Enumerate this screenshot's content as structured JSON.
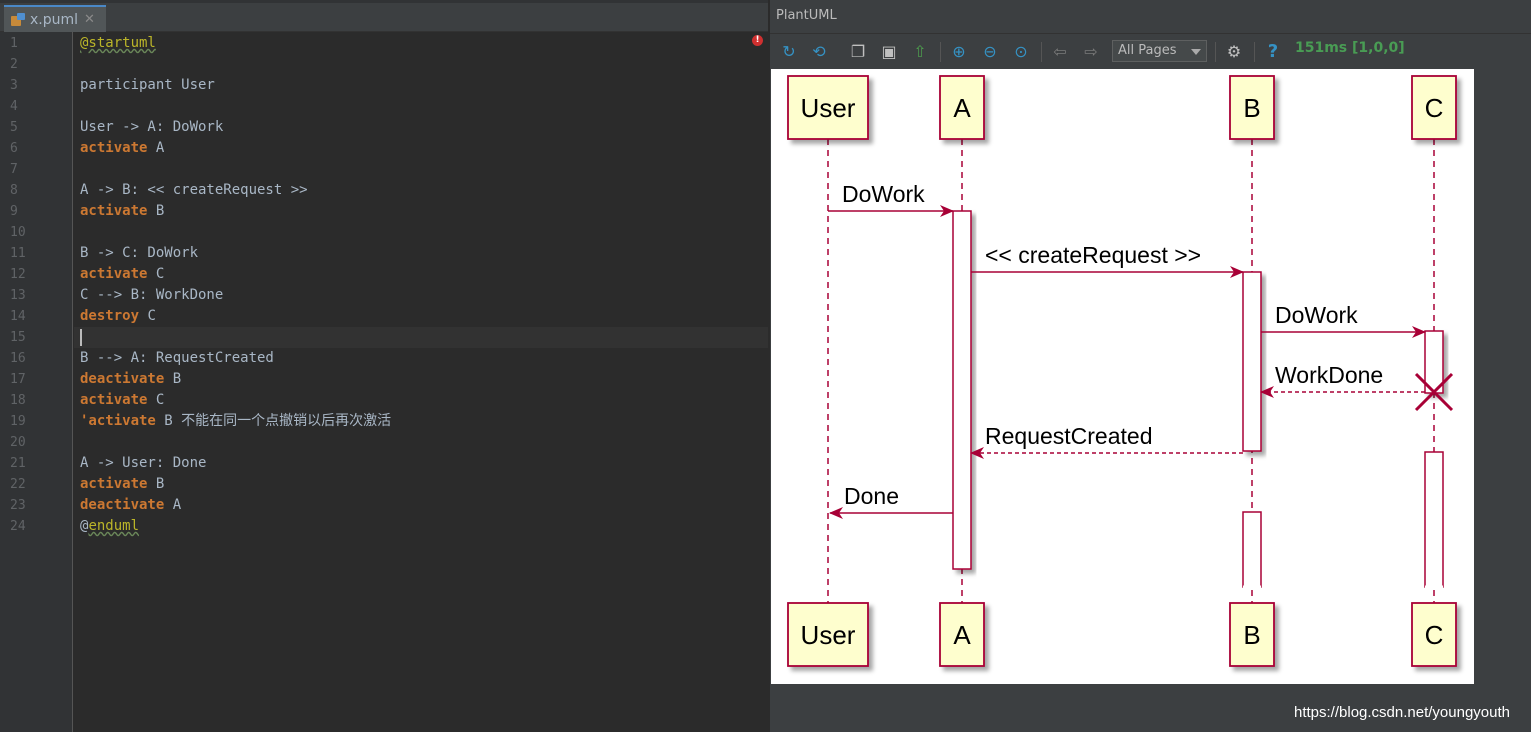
{
  "editor": {
    "tab": {
      "filename": "x.puml",
      "close": "✕"
    },
    "lines": [
      {
        "no": "1",
        "parts": [
          [
            "an",
            "@startuml"
          ]
        ]
      },
      {
        "no": "2",
        "parts": []
      },
      {
        "no": "3",
        "parts": [
          [
            "t",
            "participant User"
          ]
        ]
      },
      {
        "no": "4",
        "parts": []
      },
      {
        "no": "5",
        "parts": [
          [
            "t",
            "User -> A: DoWork"
          ]
        ]
      },
      {
        "no": "6",
        "parts": [
          [
            "kw",
            "activate"
          ],
          [
            "t",
            " A"
          ]
        ]
      },
      {
        "no": "7",
        "parts": []
      },
      {
        "no": "8",
        "parts": [
          [
            "t",
            "A -> B: << createRequest >>"
          ]
        ]
      },
      {
        "no": "9",
        "parts": [
          [
            "kw",
            "activate"
          ],
          [
            "t",
            " B"
          ]
        ]
      },
      {
        "no": "10",
        "parts": []
      },
      {
        "no": "11",
        "parts": [
          [
            "t",
            "B -> C: DoWork"
          ]
        ]
      },
      {
        "no": "12",
        "parts": [
          [
            "kw",
            "activate"
          ],
          [
            "t",
            " C"
          ]
        ]
      },
      {
        "no": "13",
        "parts": [
          [
            "t",
            "C --> B: WorkDone"
          ]
        ]
      },
      {
        "no": "14",
        "parts": [
          [
            "kw",
            "destroy"
          ],
          [
            "t",
            " C"
          ]
        ]
      },
      {
        "no": "15",
        "parts": [
          [
            "caret",
            ""
          ]
        ],
        "current": true
      },
      {
        "no": "16",
        "parts": [
          [
            "t",
            "B --> A: RequestCreated"
          ]
        ]
      },
      {
        "no": "17",
        "parts": [
          [
            "kw",
            "deactivate"
          ],
          [
            "t",
            " B"
          ]
        ]
      },
      {
        "no": "18",
        "parts": [
          [
            "kw",
            "activate"
          ],
          [
            "t",
            " C"
          ]
        ]
      },
      {
        "no": "19",
        "parts": [
          [
            "kw",
            "'activate"
          ],
          [
            "t",
            " B 不能在同一个点撤销以后再次激活"
          ]
        ]
      },
      {
        "no": "20",
        "parts": []
      },
      {
        "no": "21",
        "parts": [
          [
            "t",
            "A -> User: Done"
          ]
        ]
      },
      {
        "no": "22",
        "parts": [
          [
            "kw",
            "activate"
          ],
          [
            "t",
            " B"
          ]
        ]
      },
      {
        "no": "23",
        "parts": [
          [
            "kw",
            "deactivate"
          ],
          [
            "t",
            " A"
          ]
        ]
      },
      {
        "no": "24",
        "parts": [
          [
            "at",
            "@"
          ],
          [
            "an",
            "enduml"
          ]
        ]
      }
    ]
  },
  "panel": {
    "title": "PlantUML",
    "pages_select": "All Pages",
    "timing": "151ms [1,0,0]",
    "help": "?"
  },
  "sequence": {
    "participants": [
      "User",
      "A",
      "B",
      "C"
    ],
    "messages": [
      {
        "from": "User",
        "to": "A",
        "label": "DoWork",
        "style": "solid"
      },
      {
        "from": "A",
        "to": "B",
        "label": "<< createRequest >>",
        "style": "solid"
      },
      {
        "from": "B",
        "to": "C",
        "label": "DoWork",
        "style": "solid"
      },
      {
        "from": "C",
        "to": "B",
        "label": "WorkDone",
        "style": "dashed"
      },
      {
        "from": "B",
        "to": "A",
        "label": "RequestCreated",
        "style": "dashed"
      },
      {
        "from": "A",
        "to": "User",
        "label": "Done",
        "style": "solid"
      }
    ],
    "destroyed": [
      "C"
    ],
    "colors": {
      "participant_fill": "#FEFECE",
      "border": "#A80036",
      "line": "#A80036",
      "background": "#FFFFFF"
    }
  },
  "watermark": "https://blog.csdn.net/youngyouth"
}
